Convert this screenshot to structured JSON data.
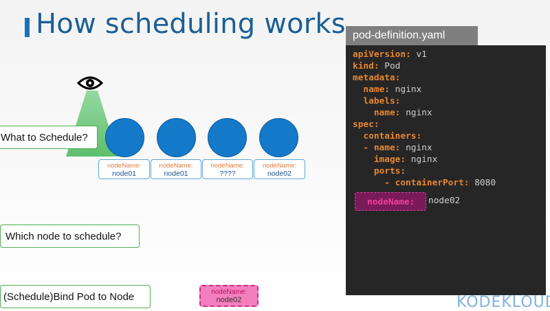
{
  "title": "How scheduling works",
  "steps": {
    "what": "What to Schedule?",
    "which": "Which node to schedule?",
    "bind": "(Schedule)Bind Pod to Node"
  },
  "nodes": [
    {
      "key": "nodeName:",
      "value": "node01"
    },
    {
      "key": "nodeName:",
      "value": "node01"
    },
    {
      "key": "nodeName:",
      "value": "????"
    },
    {
      "key": "nodeName:",
      "value": "node02"
    }
  ],
  "bind_pod": {
    "key": "nodeName:",
    "value": "node02"
  },
  "yaml": {
    "filename": "pod-definition.yaml",
    "lines": [
      {
        "indent": "",
        "key": "apiVersion:",
        "value": " v1"
      },
      {
        "indent": "",
        "key": "kind:",
        "value": " Pod"
      },
      {
        "indent": "",
        "key": "metadata:",
        "value": ""
      },
      {
        "indent": "  ",
        "key": "name:",
        "value": " nginx"
      },
      {
        "indent": "  ",
        "key": "labels:",
        "value": ""
      },
      {
        "indent": "    ",
        "key": "name:",
        "value": " nginx"
      },
      {
        "indent": "",
        "key": "spec:",
        "value": ""
      },
      {
        "indent": "  ",
        "key": "containers:",
        "value": ""
      },
      {
        "indent": "  - ",
        "key": "name:",
        "value": " nginx"
      },
      {
        "indent": "    ",
        "key": "image:",
        "value": " nginx"
      },
      {
        "indent": "    ",
        "key": "ports:",
        "value": ""
      },
      {
        "indent": "      - ",
        "key": "containerPort:",
        "value": " 8080"
      }
    ],
    "node_name_key": "nodeName:",
    "node_name_value": "node02"
  },
  "logo": "KODEKLOUD",
  "icons": {
    "eye": "eye-icon"
  },
  "colors": {
    "title": "#1a5f96",
    "node": "#1479c9",
    "scheduler_cone": "#5cc16a",
    "step_border": "#4caf50",
    "yaml_key": "#e8862f",
    "yaml_highlight": "#ef3f9b",
    "bind_fill": "#f37fbe"
  }
}
